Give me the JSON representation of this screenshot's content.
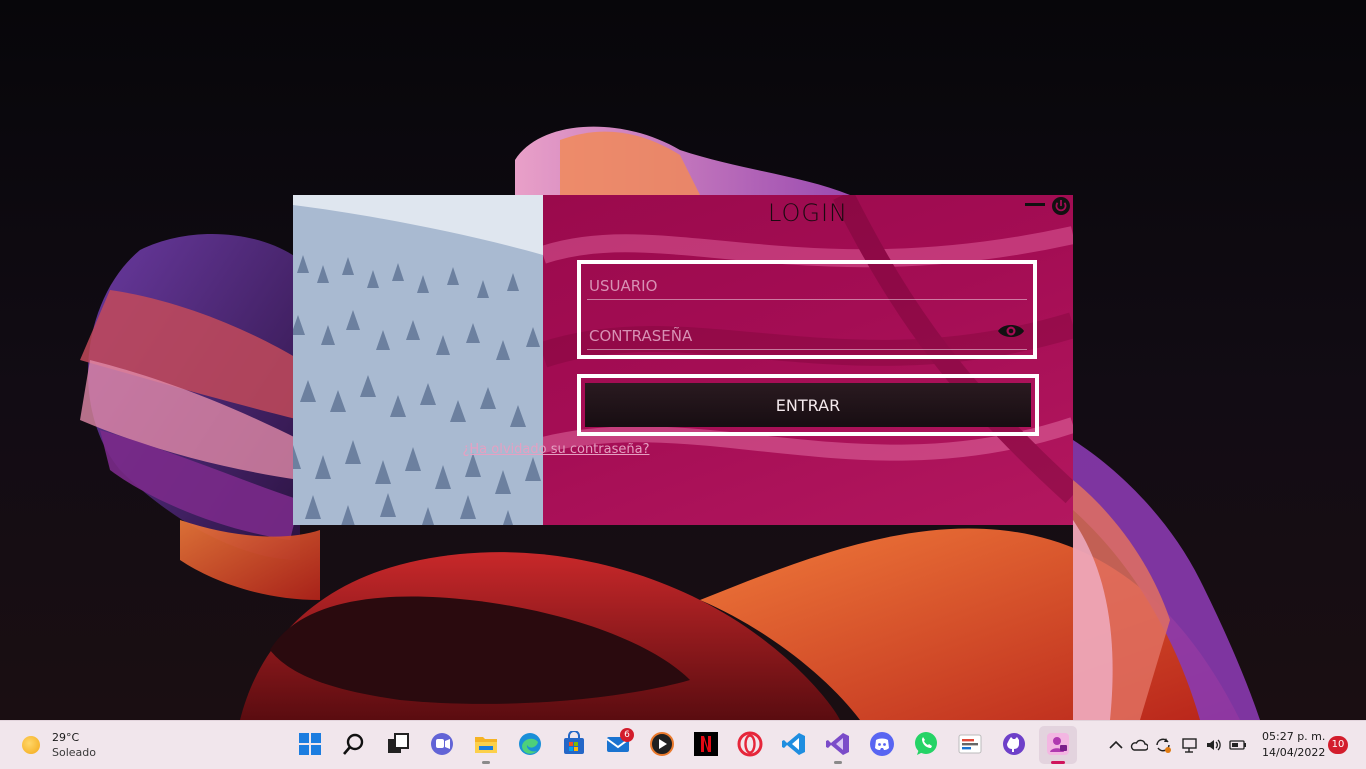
{
  "login": {
    "title": "LOGIN",
    "username_placeholder": "USUARIO",
    "password_placeholder": "CONTRASEÑA",
    "enter_label": "ENTRAR",
    "forgot_link": "¿Ha olvidado su contraseña?"
  },
  "taskbar": {
    "weather": {
      "temp": "29°C",
      "desc": "Soleado",
      "icon": "sun-icon"
    },
    "apps": [
      {
        "name": "start-icon"
      },
      {
        "name": "search-icon"
      },
      {
        "name": "task-view-icon"
      },
      {
        "name": "teams-chat-icon"
      },
      {
        "name": "file-explorer-icon"
      },
      {
        "name": "edge-icon"
      },
      {
        "name": "microsoft-store-icon"
      },
      {
        "name": "mail-icon",
        "badge": "6"
      },
      {
        "name": "media-player-icon"
      },
      {
        "name": "netflix-icon"
      },
      {
        "name": "opera-icon"
      },
      {
        "name": "vscode-icon"
      },
      {
        "name": "visual-studio-icon"
      },
      {
        "name": "discord-icon"
      },
      {
        "name": "whatsapp-icon"
      },
      {
        "name": "app-list-icon"
      },
      {
        "name": "github-icon"
      },
      {
        "name": "login-app-icon"
      }
    ],
    "clock": {
      "time": "05:27 p. m.",
      "date": "14/04/2022"
    },
    "notifications": "10"
  },
  "colors": {
    "panel": "#a40d54",
    "taskbar": "#f1e6ec",
    "button": "#1a0f14",
    "badge": "#d31d2c"
  }
}
